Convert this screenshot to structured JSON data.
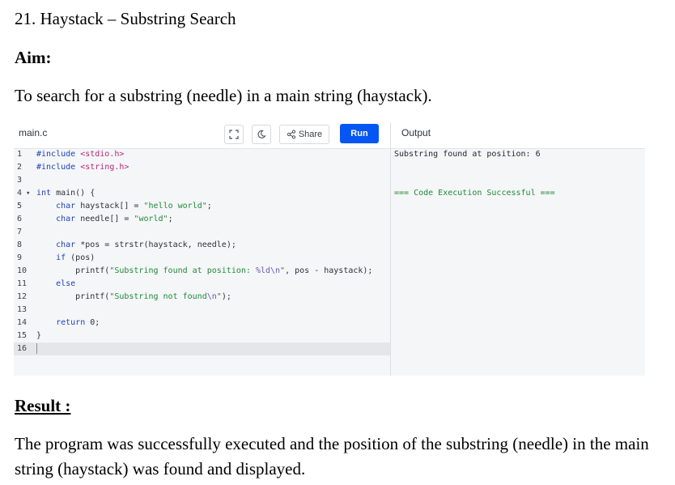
{
  "document": {
    "title": "21. Haystack – Substring Search",
    "aim_heading": "Aim:",
    "aim_text": "To search for a substring (needle) in a main string (haystack).",
    "result_heading": "Result :",
    "result_text": "The program was successfully executed and the position of the substring (needle) in the main string (haystack) was found and displayed."
  },
  "editor": {
    "file_tab": "main.c",
    "share_label": "Share",
    "run_label": "Run",
    "toolbar_icons": [
      "fullscreen-icon",
      "theme-toggle-icon",
      "share-icon"
    ],
    "colors": {
      "run_button": "#0556f3",
      "keyword": "#2043b8",
      "string": "#1f8a3a",
      "include": "#b9277a",
      "success": "#1e8b34"
    },
    "line_numbers": [
      "1",
      "2",
      "3",
      "4",
      "5",
      "6",
      "7",
      "8",
      "9",
      "10",
      "11",
      "12",
      "13",
      "14",
      "15",
      "16"
    ],
    "fold_markers": {
      "4": "▾"
    },
    "code_lines": [
      "#include <stdio.h>",
      "#include <string.h>",
      "",
      "int main() {",
      "    char haystack[] = \"hello world\";",
      "    char needle[] = \"world\";",
      "",
      "    char *pos = strstr(haystack, needle);",
      "    if (pos)",
      "        printf(\"Substring found at position: %ld\\n\", pos - haystack);",
      "    else",
      "        printf(\"Substring not found\\n\");",
      "",
      "    return 0;",
      "}",
      ""
    ]
  },
  "output": {
    "title": "Output",
    "lines": [
      "Substring found at position: 6",
      "=== Code Execution Successful ==="
    ]
  }
}
